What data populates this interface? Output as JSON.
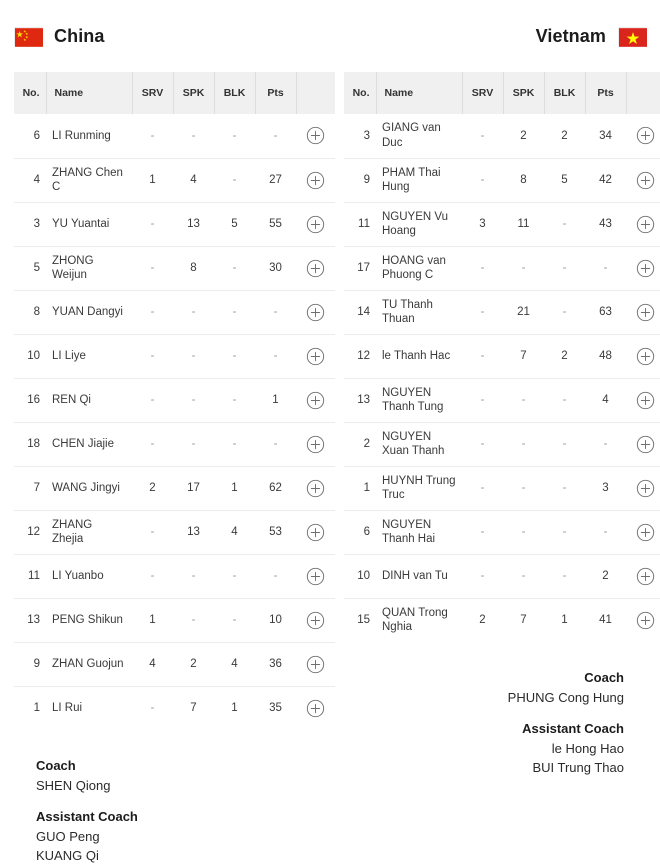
{
  "colors": {
    "header_bg": "#f0f0f0",
    "row_border": "#ececec",
    "text": "#3a3a3a",
    "china_flag_red": "#de2910",
    "china_flag_yellow": "#ffde00",
    "vietnam_flag_red": "#da251d",
    "vietnam_flag_yellow": "#ffff00"
  },
  "columns": {
    "no": "No.",
    "name": "Name",
    "srv": "SRV",
    "spk": "SPK",
    "blk": "BLK",
    "pts": "Pts",
    "action": ""
  },
  "icons": {
    "add": "plus-circle-icon",
    "flag_china": "china-flag-icon",
    "flag_vietnam": "vietnam-flag-icon"
  },
  "teams": [
    {
      "name": "China",
      "flag": "china-flag-icon",
      "align": "left",
      "players": [
        {
          "no": "6",
          "name": "LI Runming",
          "srv": "-",
          "spk": "-",
          "blk": "-",
          "pts": "-"
        },
        {
          "no": "4",
          "name": "ZHANG Chen C",
          "srv": "1",
          "spk": "4",
          "blk": "-",
          "pts": "27"
        },
        {
          "no": "3",
          "name": "YU Yuantai",
          "srv": "-",
          "spk": "13",
          "blk": "5",
          "pts": "55"
        },
        {
          "no": "5",
          "name": "ZHONG Weijun",
          "srv": "-",
          "spk": "8",
          "blk": "-",
          "pts": "30"
        },
        {
          "no": "8",
          "name": "YUAN Dangyi",
          "srv": "-",
          "spk": "-",
          "blk": "-",
          "pts": "-"
        },
        {
          "no": "10",
          "name": "LI Liye",
          "srv": "-",
          "spk": "-",
          "blk": "-",
          "pts": "-"
        },
        {
          "no": "16",
          "name": "REN Qi",
          "srv": "-",
          "spk": "-",
          "blk": "-",
          "pts": "1"
        },
        {
          "no": "18",
          "name": "CHEN Jiajie",
          "srv": "-",
          "spk": "-",
          "blk": "-",
          "pts": "-"
        },
        {
          "no": "7",
          "name": "WANG Jingyi",
          "srv": "2",
          "spk": "17",
          "blk": "1",
          "pts": "62"
        },
        {
          "no": "12",
          "name": "ZHANG Zhejia",
          "srv": "-",
          "spk": "13",
          "blk": "4",
          "pts": "53"
        },
        {
          "no": "11",
          "name": "LI Yuanbo",
          "srv": "-",
          "spk": "-",
          "blk": "-",
          "pts": "-"
        },
        {
          "no": "13",
          "name": "PENG Shikun",
          "srv": "1",
          "spk": "-",
          "blk": "-",
          "pts": "10"
        },
        {
          "no": "9",
          "name": "ZHAN Guojun",
          "srv": "4",
          "spk": "2",
          "blk": "4",
          "pts": "36"
        },
        {
          "no": "1",
          "name": "LI Rui",
          "srv": "-",
          "spk": "7",
          "blk": "1",
          "pts": "35"
        }
      ],
      "staff": [
        {
          "role": "Coach",
          "people": [
            "SHEN Qiong"
          ]
        },
        {
          "role": "Assistant Coach",
          "people": [
            "GUO Peng",
            "KUANG Qi"
          ]
        }
      ]
    },
    {
      "name": "Vietnam",
      "flag": "vietnam-flag-icon",
      "align": "right",
      "players": [
        {
          "no": "3",
          "name": "GIANG van Duc",
          "srv": "-",
          "spk": "2",
          "blk": "2",
          "pts": "34"
        },
        {
          "no": "9",
          "name": "PHAM Thai Hung",
          "srv": "-",
          "spk": "8",
          "blk": "5",
          "pts": "42"
        },
        {
          "no": "11",
          "name": "NGUYEN Vu Hoang",
          "srv": "3",
          "spk": "11",
          "blk": "-",
          "pts": "43"
        },
        {
          "no": "17",
          "name": "HOANG van Phuong C",
          "srv": "-",
          "spk": "-",
          "blk": "-",
          "pts": "-"
        },
        {
          "no": "14",
          "name": "TU Thanh Thuan",
          "srv": "-",
          "spk": "21",
          "blk": "-",
          "pts": "63"
        },
        {
          "no": "12",
          "name": "le Thanh Hac",
          "srv": "-",
          "spk": "7",
          "blk": "2",
          "pts": "48"
        },
        {
          "no": "13",
          "name": "NGUYEN Thanh Tung",
          "srv": "-",
          "spk": "-",
          "blk": "-",
          "pts": "4"
        },
        {
          "no": "2",
          "name": "NGUYEN Xuan Thanh",
          "srv": "-",
          "spk": "-",
          "blk": "-",
          "pts": "-"
        },
        {
          "no": "1",
          "name": "HUYNH Trung Truc",
          "srv": "-",
          "spk": "-",
          "blk": "-",
          "pts": "3"
        },
        {
          "no": "6",
          "name": "NGUYEN Thanh Hai",
          "srv": "-",
          "spk": "-",
          "blk": "-",
          "pts": "-"
        },
        {
          "no": "10",
          "name": "DINH van Tu",
          "srv": "-",
          "spk": "-",
          "blk": "-",
          "pts": "2"
        },
        {
          "no": "15",
          "name": "QUAN Trong Nghia",
          "srv": "2",
          "spk": "7",
          "blk": "1",
          "pts": "41"
        }
      ],
      "staff": [
        {
          "role": "Coach",
          "people": [
            "PHUNG Cong Hung"
          ]
        },
        {
          "role": "Assistant Coach",
          "people": [
            "le Hong Hao",
            "BUI Trung Thao"
          ]
        }
      ]
    }
  ]
}
